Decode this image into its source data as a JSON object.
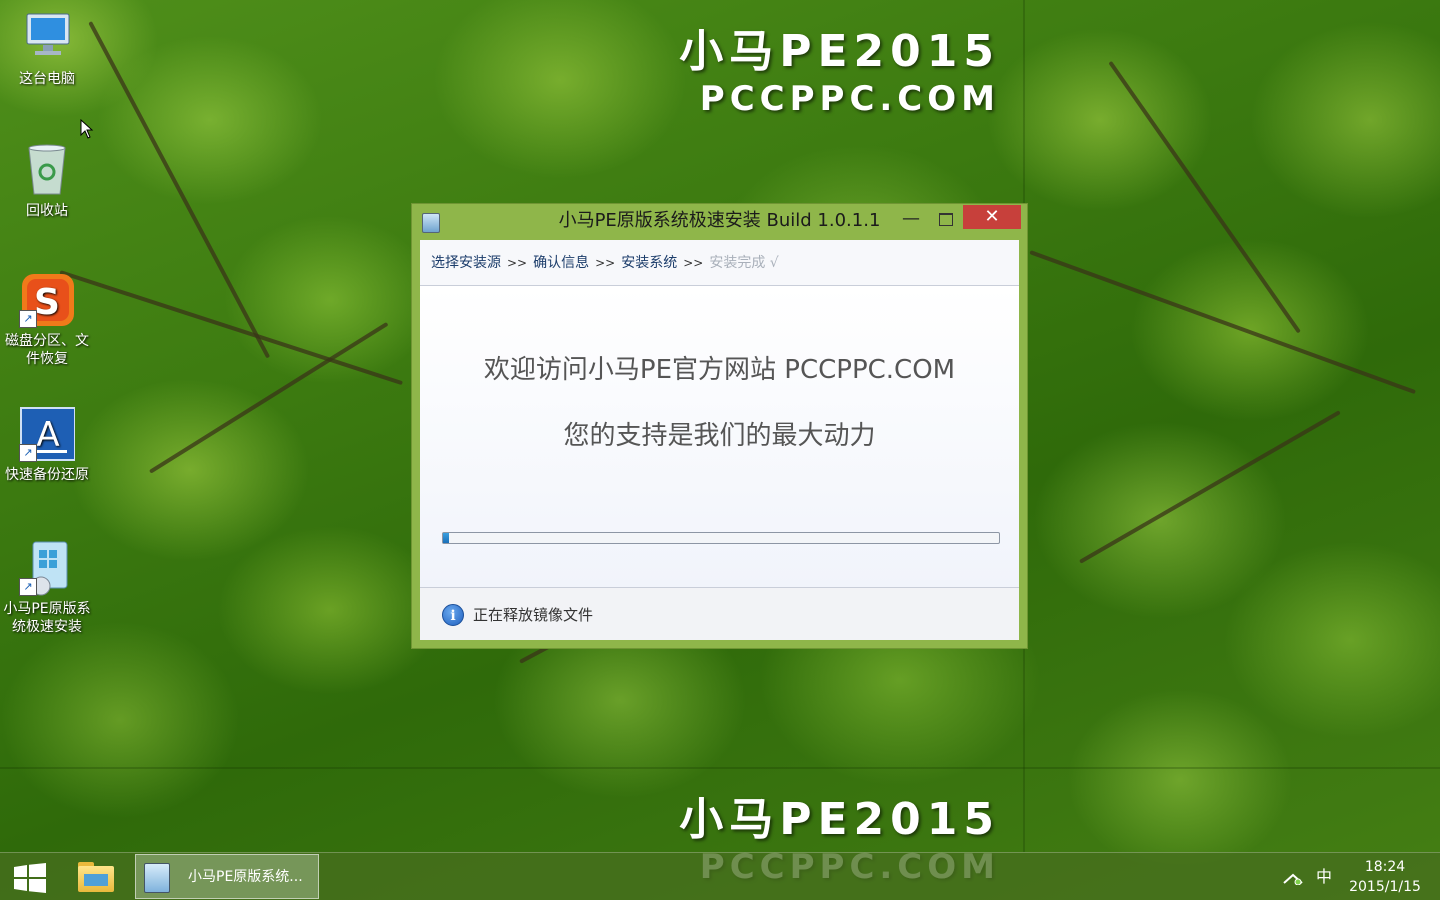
{
  "wallpaper": {
    "brand_title": "小马PE2015",
    "brand_url": "PCCPPC.COM"
  },
  "desktop_icons": [
    {
      "label": "这台电脑",
      "icon": "computer-icon"
    },
    {
      "label": "回收站",
      "icon": "recycle-bin-icon"
    },
    {
      "label": "磁盘分区、文件恢复",
      "icon": "disk-partition-icon"
    },
    {
      "label": "快速备份还原",
      "icon": "backup-restore-icon"
    },
    {
      "label": "小马PE原版系统极速安装",
      "icon": "installer-icon"
    }
  ],
  "window": {
    "title": "小马PE原版系统极速安装 Build 1.0.1.1",
    "minimize_glyph": "—",
    "close_glyph": "✕",
    "steps": [
      {
        "label": "选择安装源",
        "state": "active"
      },
      {
        "label": "确认信息",
        "state": "active"
      },
      {
        "label": "安装系统",
        "state": "active"
      },
      {
        "label": "安装完成 √",
        "state": "pending"
      }
    ],
    "step_separator": ">>",
    "message_line1": "欢迎访问小马PE官方网站 PCCPPC.COM",
    "message_line2": "您的支持是我们的最大动力",
    "progress_fraction": 0.01,
    "status_icon_glyph": "i",
    "status_text": "正在释放镜像文件"
  },
  "taskbar": {
    "task_label": "小马PE原版系统...",
    "ime_indicator": "中",
    "time": "18:24",
    "date": "2015/1/15"
  },
  "colors": {
    "close_button": "#c7403b",
    "window_frame": "#8fb64a",
    "progress_fill": "#1a6fb8"
  }
}
